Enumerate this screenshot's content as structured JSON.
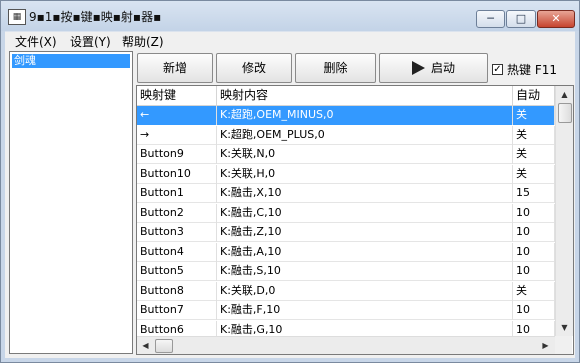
{
  "window": {
    "title": "9▪1▪按▪键▪映▪射▪器▪",
    "min": "─",
    "max": "□",
    "close": "✕"
  },
  "menu": [
    {
      "label": "文件(X)"
    },
    {
      "label": "设置(Y)"
    },
    {
      "label": "帮助(Z)"
    }
  ],
  "left_list": {
    "selected": "剑魂"
  },
  "toolbar": {
    "add": "新增",
    "edit": "修改",
    "delete": "删除",
    "start": "启动",
    "hotkey_checked": true,
    "hotkey_label": "热键 F11"
  },
  "table": {
    "headers": [
      "映射键",
      "映射内容",
      "自动"
    ],
    "rows": [
      [
        "←",
        "K:超跑,OEM_MINUS,0",
        "关"
      ],
      [
        "→",
        "K:超跑,OEM_PLUS,0",
        "关"
      ],
      [
        "Button9",
        "K:关联,N,0",
        "关"
      ],
      [
        "Button10",
        "K:关联,H,0",
        "关"
      ],
      [
        "Button1",
        "K:融击,X,10",
        "15"
      ],
      [
        "Button2",
        "K:融击,C,10",
        "10"
      ],
      [
        "Button3",
        "K:融击,Z,10",
        "10"
      ],
      [
        "Button4",
        "K:融击,A,10",
        "10"
      ],
      [
        "Button5",
        "K:融击,S,10",
        "10"
      ],
      [
        "Button8",
        "K:关联,D,0",
        "关"
      ],
      [
        "Button7",
        "K:融击,F,10",
        "10"
      ],
      [
        "Button6",
        "K:融击,G,10",
        "10"
      ]
    ],
    "selected_row": 0
  },
  "scroll": {
    "up": "▲",
    "down": "▼",
    "left": "◀",
    "right": "▶"
  }
}
